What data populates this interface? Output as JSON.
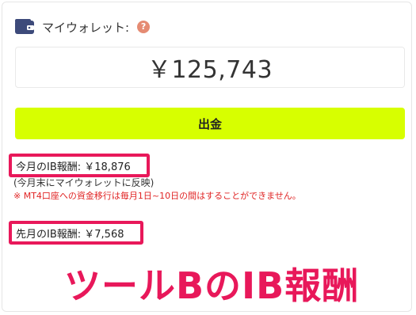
{
  "wallet": {
    "title": "マイウォレット:",
    "help_symbol": "?",
    "icon": "wallet-icon",
    "balance": "￥125,743"
  },
  "withdraw": {
    "label": "出金",
    "color": "#d7ff00"
  },
  "ib_reward": {
    "current_month": "今月のIB報酬: ￥18,876",
    "reflect_note": "(今月末にマイウォレットに反映)",
    "warning": "※ MT4口座への資金移行は毎月1日~10日の間はすることができません。",
    "last_month": "先月のIB報酬: ￥7,568"
  },
  "annotation": {
    "caption": "ツールBのIB報酬",
    "color": "#e8185a"
  }
}
